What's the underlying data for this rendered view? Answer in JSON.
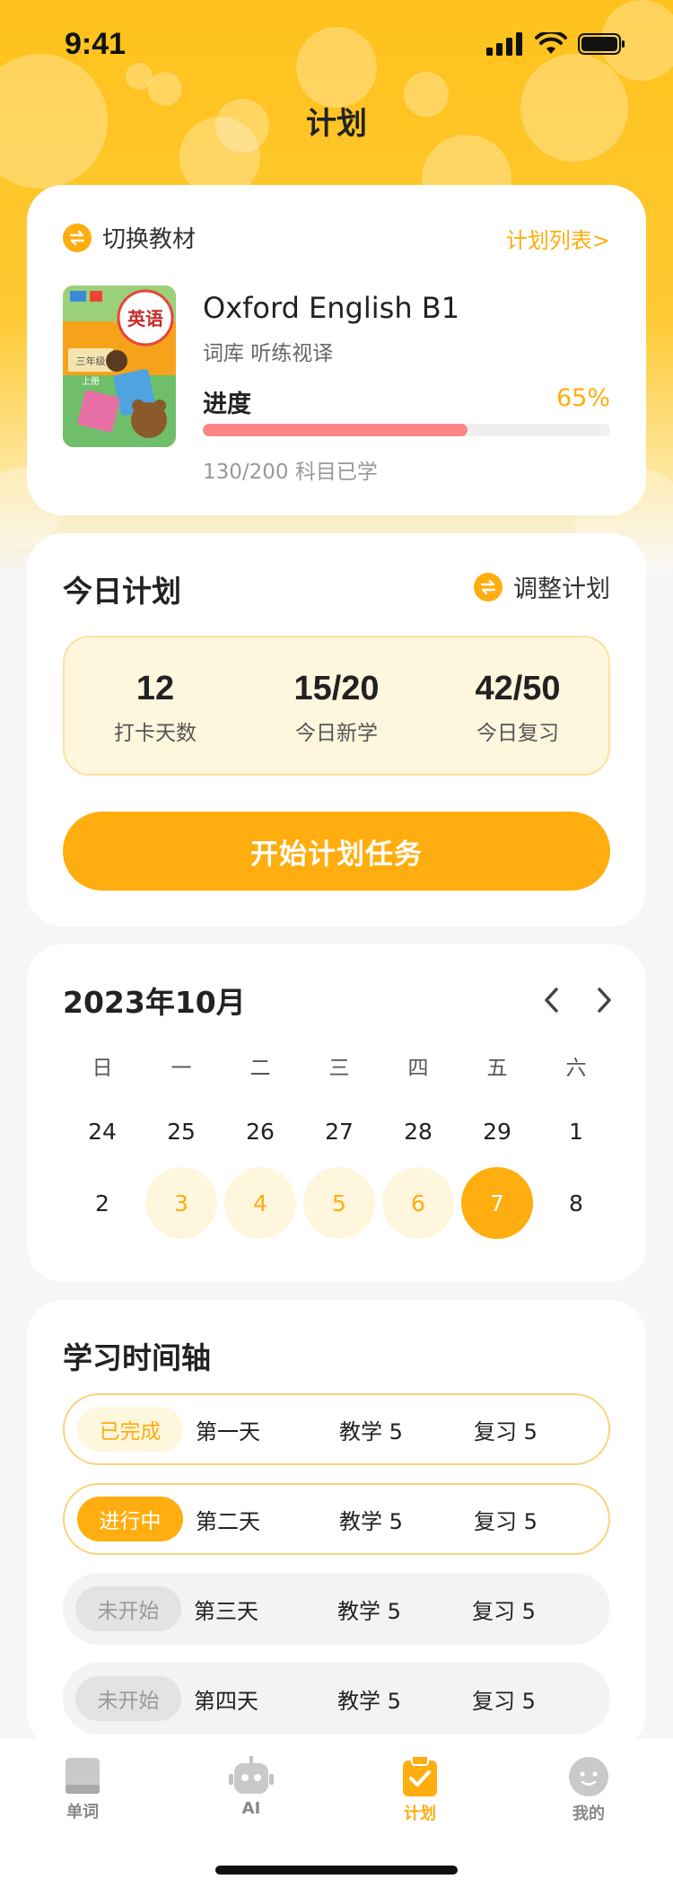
{
  "status": {
    "time": "9:41"
  },
  "page_title": "计划",
  "book": {
    "switch_label": "切换教材",
    "plan_list_label": "计划列表>",
    "cover_title": "英语",
    "cover_grade": "三年级",
    "cover_term": "上册",
    "title": "Oxford English B1",
    "subtitle": "词库 听练视译",
    "progress_label": "进度",
    "progress_pct_text": "65%",
    "progress_value": 0.65,
    "progress_count": "130/200 科目已学"
  },
  "today": {
    "title": "今日计划",
    "adjust_label": "调整计划",
    "stats": [
      {
        "value": "12",
        "label": "打卡天数"
      },
      {
        "value": "15/20",
        "label": "今日新学"
      },
      {
        "value": "42/50",
        "label": "今日复习"
      }
    ],
    "start_button": "开始计划任务"
  },
  "calendar": {
    "month_title": "2023年10月",
    "weekdays": [
      "日",
      "一",
      "二",
      "三",
      "四",
      "五",
      "六"
    ],
    "week1": [
      "24",
      "25",
      "26",
      "27",
      "28",
      "29",
      "1"
    ],
    "week2": [
      "2",
      "3",
      "4",
      "5",
      "6",
      "7",
      "8"
    ]
  },
  "timeline": {
    "title": "学习时间轴",
    "rows": [
      {
        "status": "已完成",
        "day": "第一天",
        "teach": "教学 5",
        "review": "复习 5"
      },
      {
        "status": "进行中",
        "day": "第二天",
        "teach": "教学 5",
        "review": "复习 5"
      },
      {
        "status": "未开始",
        "day": "第三天",
        "teach": "教学 5",
        "review": "复习 5"
      },
      {
        "status": "未开始",
        "day": "第四天",
        "teach": "教学 5",
        "review": "复习 5"
      }
    ]
  },
  "tabs": [
    {
      "label": "单词",
      "icon": "book-icon"
    },
    {
      "label": "AI",
      "icon": "robot-icon"
    },
    {
      "label": "计划",
      "icon": "clipboard-check-icon"
    },
    {
      "label": "我的",
      "icon": "profile-icon"
    }
  ],
  "colors": {
    "accent": "#ffad0f",
    "progress": "#fb8686",
    "hero": "#ffc21c"
  }
}
